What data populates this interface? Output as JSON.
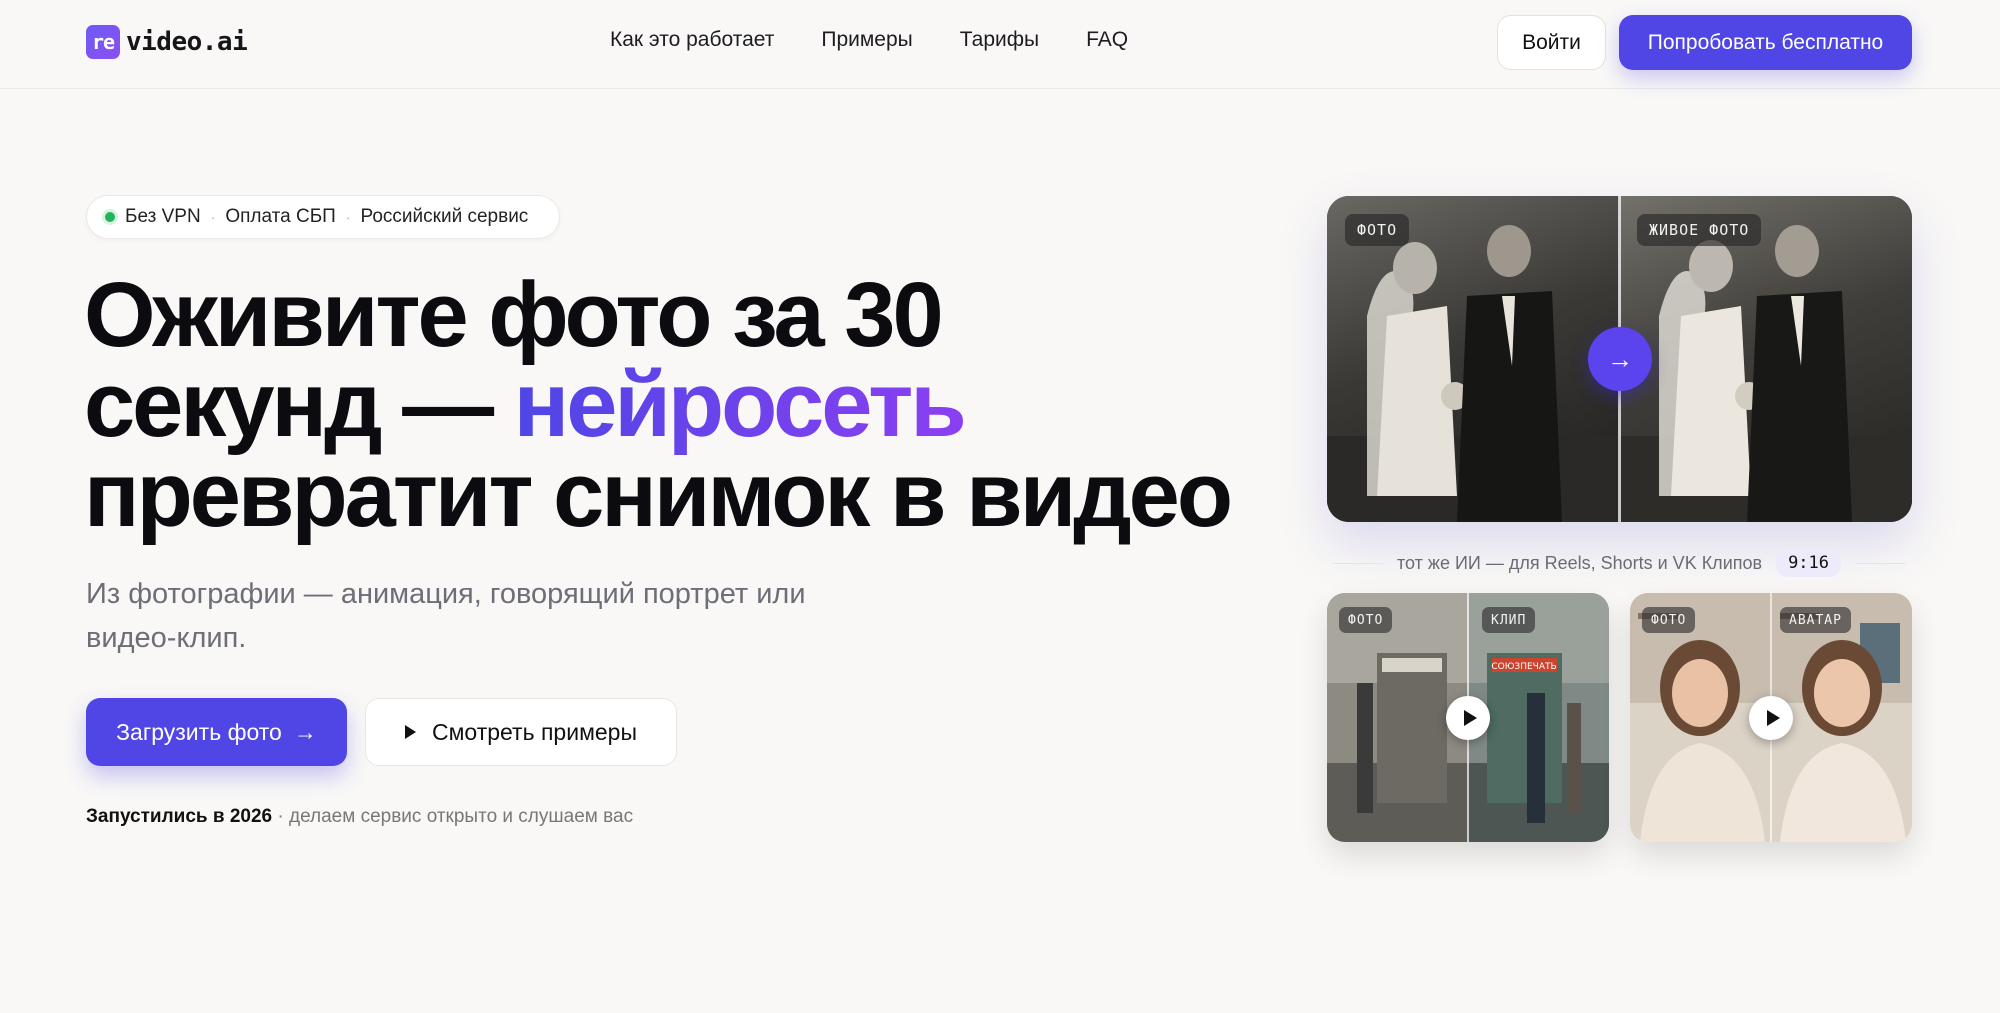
{
  "header": {
    "logo_badge": "re",
    "logo_text": "video.ai",
    "nav": [
      "Как это работает",
      "Примеры",
      "Тарифы",
      "FAQ"
    ],
    "login_label": "Войти",
    "try_label": "Попробовать бесплатно"
  },
  "hero": {
    "pill": [
      "Без VPN",
      "Оплата СБП",
      "Российский сервис"
    ],
    "pill_separator": "·",
    "headline_1": "Оживите фото за 30",
    "headline_2a": "секунд — ",
    "headline_2b": "нейросеть",
    "headline_3": "превратит снимок в видео",
    "subtitle": "Из фотографии — анимация, говорящий портрет или видео-клип.",
    "upload_label": "Загрузить фото",
    "upload_arrow": "→",
    "examples_label": "Смотреть примеры",
    "launch_bold": "Запустились в 2026",
    "launch_rest": " · делаем сервис открыто и слушаем вас"
  },
  "showcase": {
    "big_left_tag": "ФОТО",
    "big_right_tag": "ЖИВОЕ ФОТО",
    "arrow": "→",
    "caption": "тот же ИИ — для Reels, Shorts и VK Клипов",
    "ratio": "9:16",
    "card1_left_tag": "ФОТО",
    "card1_right_tag": "КЛИП",
    "card2_left_tag": "ФОТО",
    "card2_right_tag": "АВАТАР",
    "kiosk_sign": "СОЮЗПЕЧАТЬ"
  },
  "colors": {
    "accent": "#4f46e5",
    "accent_gradient_end": "#8b3ff2",
    "status_dot": "#22b45a"
  }
}
